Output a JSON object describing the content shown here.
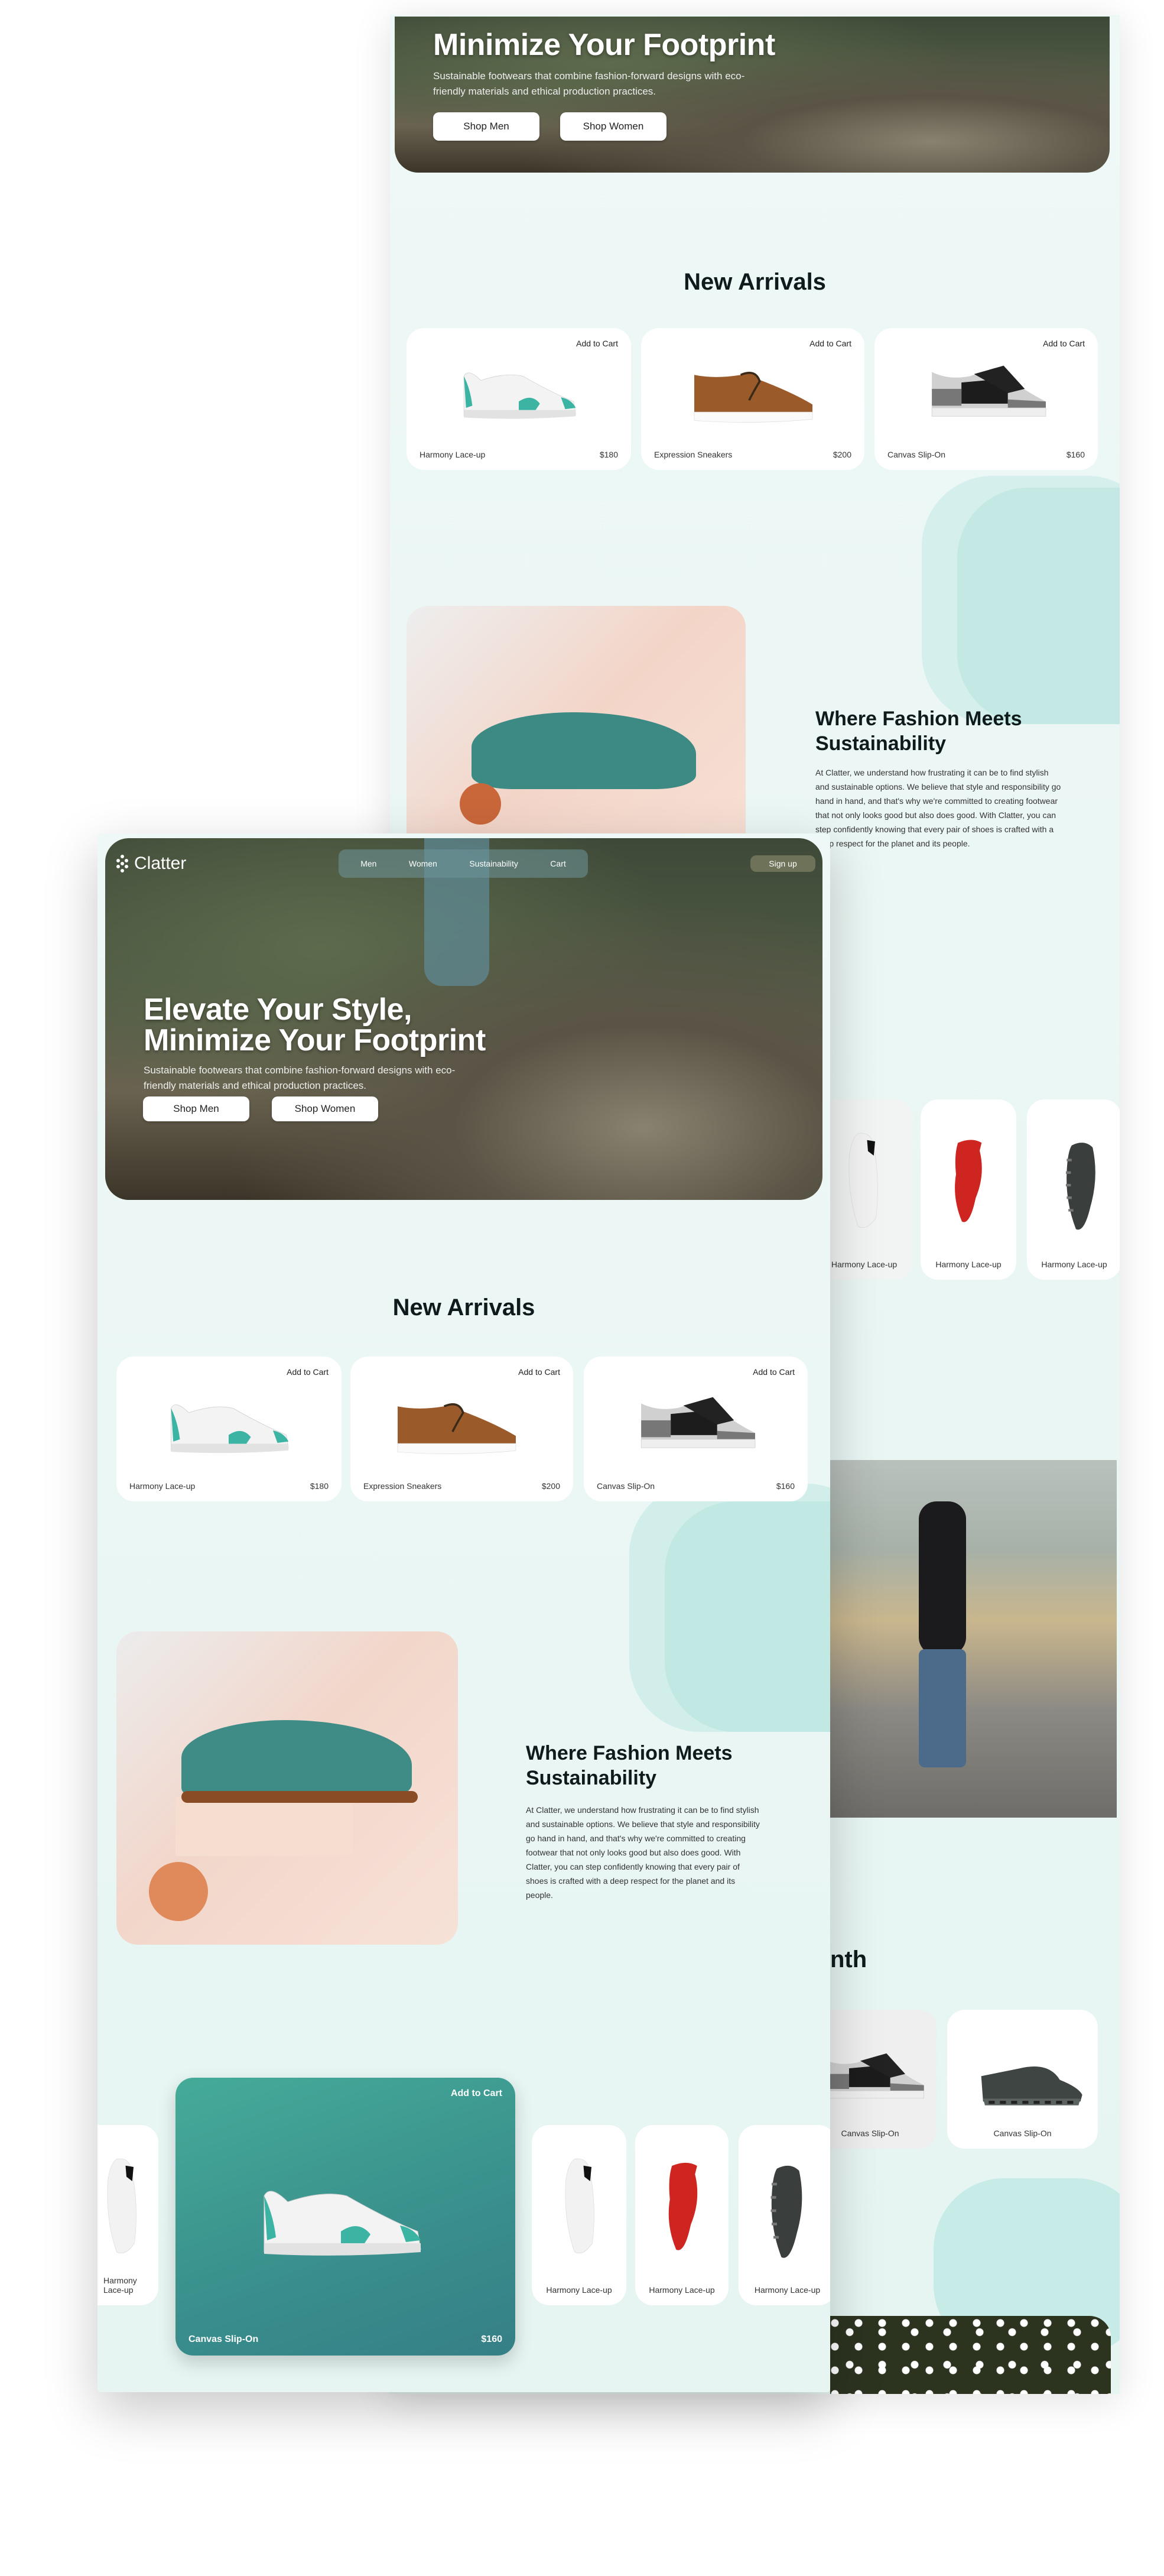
{
  "brand": {
    "name": "Clatter"
  },
  "nav": {
    "items": [
      "Men",
      "Women",
      "Sustainability",
      "Cart"
    ],
    "signup": "Sign up"
  },
  "hero": {
    "title_line1": "Elevate Your Style,",
    "title_line2": "Minimize Your Footprint",
    "subtitle": "Sustainable footwears that combine fashion-forward designs with eco-friendly materials and ethical production practices.",
    "shop_men": "Shop Men",
    "shop_women": "Shop Women"
  },
  "new_arrivals": {
    "title": "New Arrivals",
    "add_to_cart": "Add to Cart",
    "products": [
      {
        "name": "Harmony Lace-up",
        "price": "$180"
      },
      {
        "name": "Expression Sneakers",
        "price": "$200"
      },
      {
        "name": "Canvas Slip-On",
        "price": "$160"
      }
    ]
  },
  "sustainability": {
    "title": "Where Fashion Meets Sustainability",
    "body": "At Clatter, we understand how frustrating it can be to find stylish and sustainable options. We believe that style and responsibility go hand in hand, and that's why we're committed to creating footwear that not only looks good but also does good. With Clatter, you can step confidently knowing that every pair of shoes is crafted with a deep respect for the planet and its people."
  },
  "carousel": {
    "featured": {
      "add_to_cart": "Add to Cart",
      "name": "Canvas Slip-On",
      "price": "$160"
    },
    "items": [
      "Harmony Lace-up",
      "Harmony Lace-up",
      "Harmony Lace-up",
      "Harmony Lace-up"
    ]
  },
  "back_page": {
    "month_heading_visible": "nth",
    "month_items": [
      "Canvas Slip-On",
      "Canvas Slip-On"
    ]
  },
  "colors": {
    "page_bg": "#e8f6f4",
    "accent_teal": "#3a9e94",
    "text_dark": "#0f1a1c"
  }
}
